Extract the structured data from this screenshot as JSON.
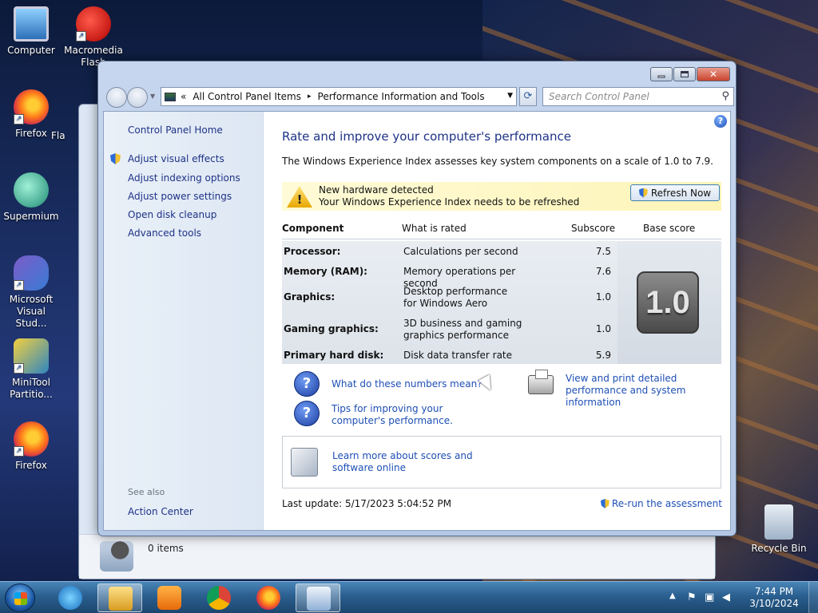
{
  "desktop": {
    "icons": [
      {
        "label_line1": "Computer",
        "label_line2": ""
      },
      {
        "label_line1": "Macromedia",
        "label_line2": "Flash"
      },
      {
        "label_line1": "Firefox",
        "label_line2": ""
      },
      {
        "label_line1": "Supermium",
        "label_line2": ""
      },
      {
        "label_line1": "Microsoft",
        "label_line2": "Visual Stud..."
      },
      {
        "label_line1": "MiniTool",
        "label_line2": "Partitio..."
      },
      {
        "label_line1": "Firefox",
        "label_line2": ""
      },
      {
        "label_line1": "Recycle Bin",
        "label_line2": ""
      }
    ],
    "partial_icon_label": "Fla"
  },
  "back_window": {
    "status_text": "0 items"
  },
  "window": {
    "address": {
      "prefix": "«",
      "crumbs": [
        "All Control Panel Items",
        "Performance Information and Tools"
      ],
      "separator": "▸"
    },
    "search": {
      "placeholder": "Search Control Panel"
    },
    "left_pane": {
      "home": "Control Panel Home",
      "tasks": [
        "Adjust visual effects",
        "Adjust indexing options",
        "Adjust power settings",
        "Open disk cleanup",
        "Advanced tools"
      ],
      "see_also_label": "See also",
      "see_also_items": [
        "Action Center"
      ]
    },
    "main": {
      "title": "Rate and improve your computer's performance",
      "subtitle": "The Windows Experience Index assesses key system components on a scale of 1.0 to 7.9.",
      "notice": {
        "line1": "New hardware detected",
        "line2": "Your Windows Experience Index needs to be refreshed",
        "button": "Refresh Now"
      },
      "table": {
        "headers": [
          "Component",
          "What is rated",
          "Subscore",
          "Base score"
        ],
        "rows": [
          {
            "component": "Processor:",
            "rated": "Calculations per second",
            "subscore": "7.5"
          },
          {
            "component": "Memory (RAM):",
            "rated": "Memory operations per second",
            "subscore": "7.6"
          },
          {
            "component": "Graphics:",
            "rated": "Desktop performance for Windows Aero",
            "subscore": "1.0"
          },
          {
            "component": "Gaming graphics:",
            "rated": "3D business and gaming graphics performance",
            "subscore": "1.0"
          },
          {
            "component": "Primary hard disk:",
            "rated": "Disk data transfer rate",
            "subscore": "5.9"
          }
        ],
        "base_score": "1.0"
      },
      "links": {
        "numbers_meaning": "What do these numbers mean?",
        "tips": "Tips for improving your computer's performance.",
        "view_print": "View and print detailed performance and system information",
        "learn_more": "Learn more about scores and software online"
      },
      "last_update": "Last update: 5/17/2023 5:04:52 PM",
      "rerun": "Re-run the assessment"
    }
  },
  "taskbar": {
    "time": "7:44 PM",
    "date": "3/10/2024"
  }
}
